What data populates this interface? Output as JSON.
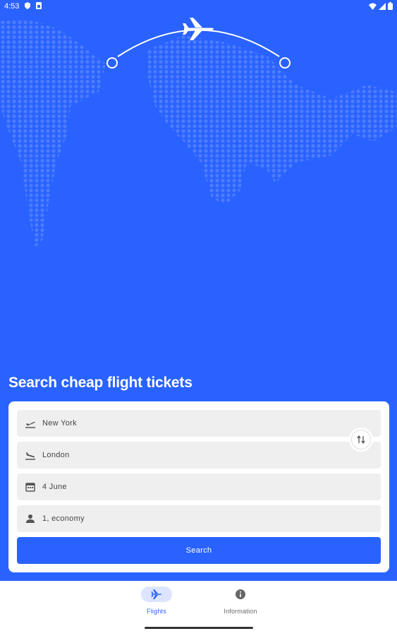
{
  "status_bar": {
    "time": "4:53",
    "left_icons": [
      "shield-icon",
      "sim-icon"
    ],
    "right_icons": [
      "wifi-icon",
      "signal-icon",
      "battery-icon"
    ]
  },
  "hero": {
    "background_color": "#2962ff",
    "illustration": [
      "world-map-dots",
      "flight-arc",
      "airplane-icon"
    ]
  },
  "search": {
    "title": "Search cheap flight tickets",
    "from": {
      "icon": "flight-takeoff-icon",
      "value": "New York"
    },
    "to": {
      "icon": "flight-land-icon",
      "value": "London"
    },
    "date": {
      "icon": "calendar-icon",
      "value": "4 June"
    },
    "passengers": {
      "icon": "person-icon",
      "value": "1, economy"
    },
    "swap_icon": "swap-icon",
    "button_label": "Search"
  },
  "bottom_nav": {
    "items": [
      {
        "label": "Flights",
        "icon": "airplane-icon",
        "active": true,
        "color": "#2962ff"
      },
      {
        "label": "Information",
        "icon": "info-icon",
        "active": false,
        "color": "#555555"
      }
    ]
  }
}
